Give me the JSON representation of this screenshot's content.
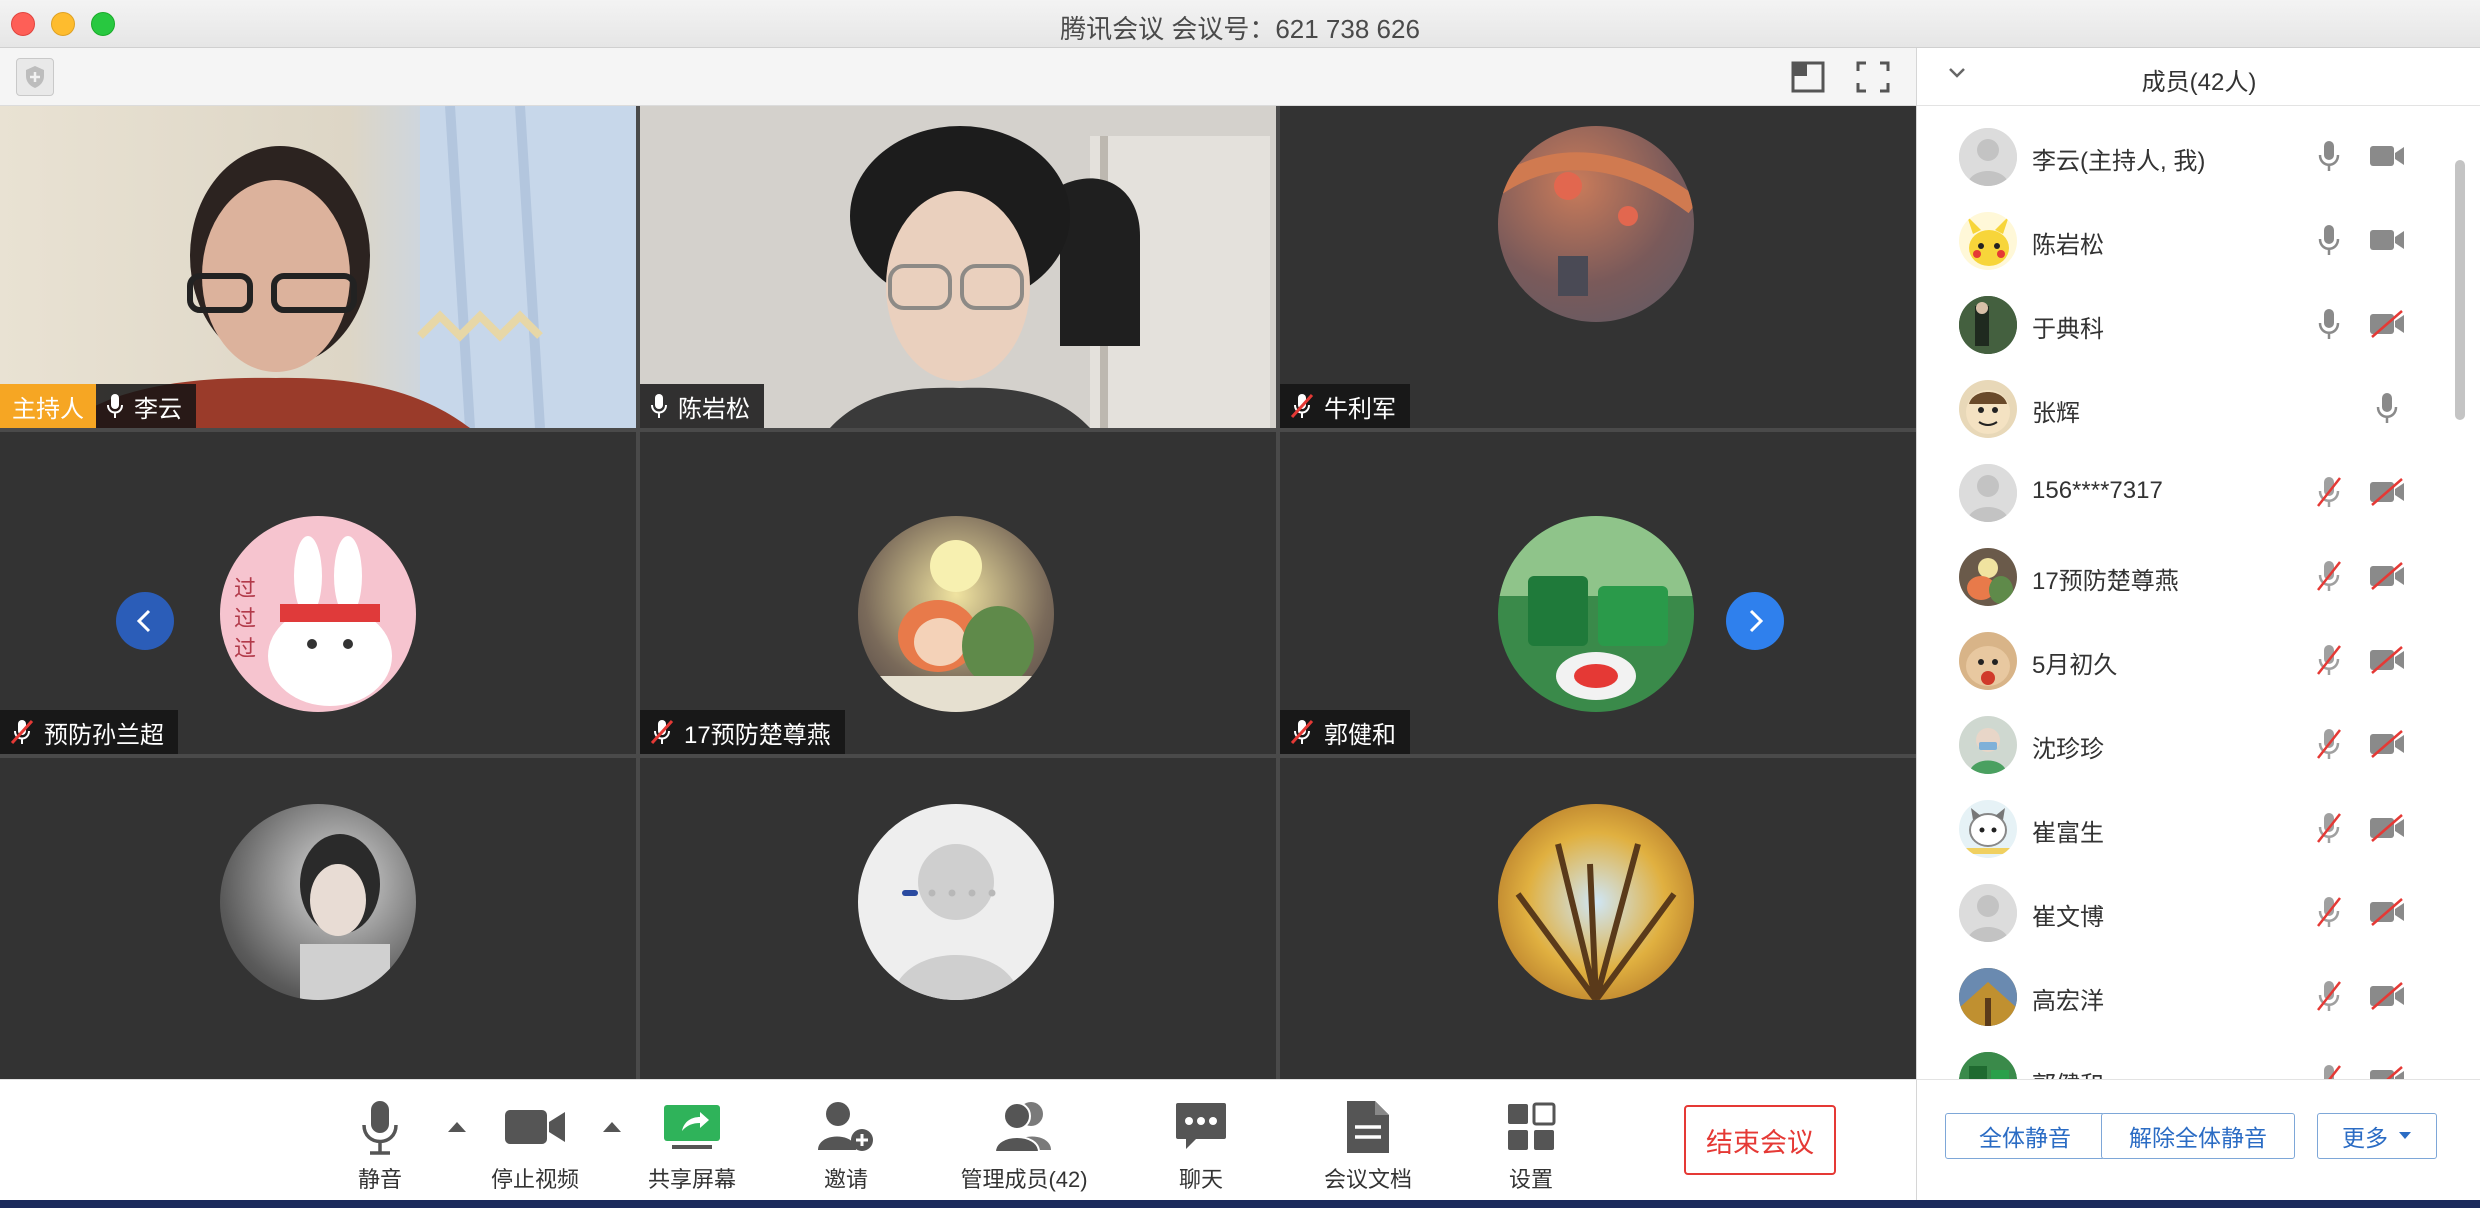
{
  "window": {
    "title": "腾讯会议 会议号：621 738 626"
  },
  "colors": {
    "accent": "#2f80ed",
    "end": "#e53935",
    "host": "#f6a623",
    "tile": "#333333"
  },
  "grid": {
    "tiles": [
      {
        "name": "李云",
        "host_label": "主持人",
        "type": "video",
        "mic": "on"
      },
      {
        "name": "陈岩松",
        "type": "video",
        "mic": "on"
      },
      {
        "name": "牛利军",
        "type": "avatar",
        "mic": "muted"
      },
      {
        "name": "预防孙兰超",
        "type": "avatar",
        "mic": "muted"
      },
      {
        "name": "17预防楚尊燕",
        "type": "avatar",
        "mic": "muted"
      },
      {
        "name": "郭健和",
        "type": "avatar",
        "mic": "muted"
      },
      {
        "name": "",
        "type": "avatar",
        "mic": ""
      },
      {
        "name": "",
        "type": "avatar",
        "mic": ""
      },
      {
        "name": "",
        "type": "avatar",
        "mic": ""
      }
    ]
  },
  "toolbar": {
    "mute": "静音",
    "stop_video": "停止视频",
    "share_screen": "共享屏幕",
    "invite": "邀请",
    "manage_members": "管理成员(42)",
    "chat": "聊天",
    "docs": "会议文档",
    "settings": "设置",
    "end_meeting": "结束会议"
  },
  "panel": {
    "title": "成员(42人)",
    "members": [
      {
        "name": "李云(主持人, 我)",
        "mic": "on",
        "cam": "on"
      },
      {
        "name": "陈岩松",
        "mic": "on",
        "cam": "on"
      },
      {
        "name": "于典科",
        "mic": "on",
        "cam": "off"
      },
      {
        "name": "张辉",
        "mic": "on",
        "cam": "none"
      },
      {
        "name": "156****7317",
        "mic": "off",
        "cam": "off"
      },
      {
        "name": "17预防楚尊燕",
        "mic": "off",
        "cam": "off"
      },
      {
        "name": "5月初久",
        "mic": "off",
        "cam": "off"
      },
      {
        "name": "沈珍珍",
        "mic": "off",
        "cam": "off"
      },
      {
        "name": "崔富生",
        "mic": "off",
        "cam": "off"
      },
      {
        "name": "崔文博",
        "mic": "off",
        "cam": "off"
      },
      {
        "name": "高宏洋",
        "mic": "off",
        "cam": "off"
      },
      {
        "name": "郭健和",
        "mic": "off",
        "cam": "off"
      }
    ],
    "mute_all": "全体静音",
    "unmute_all": "解除全体静音",
    "more": "更多"
  }
}
